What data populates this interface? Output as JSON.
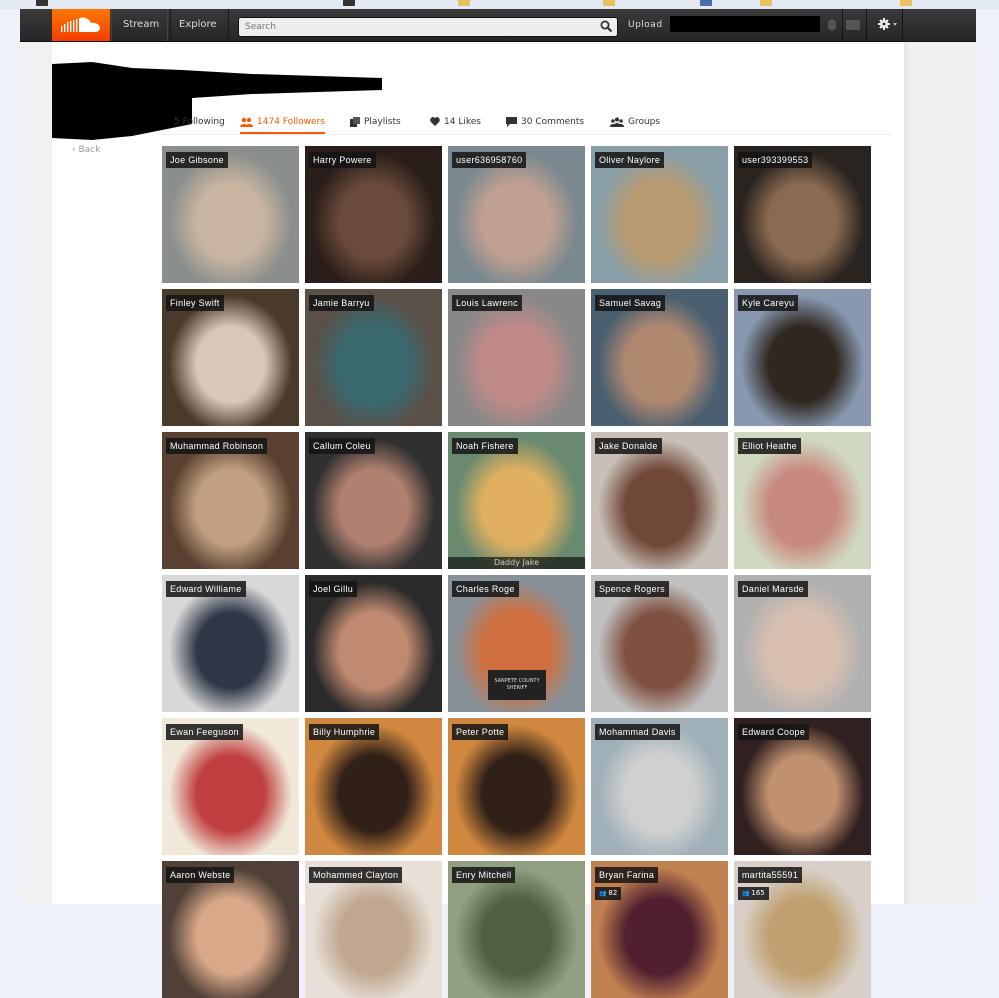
{
  "nav": {
    "stream": "Stream",
    "explore": "Explore",
    "search_placeholder": "Search",
    "upload": "Upload",
    "brand_color": "#ff5500"
  },
  "tabs": [
    {
      "label": "5 Following",
      "icon": "users-icon",
      "active": false
    },
    {
      "label": "1474 Followers",
      "icon": "users-icon",
      "active": true
    },
    {
      "label": "Playlists",
      "icon": "playlist-icon",
      "active": false
    },
    {
      "label": "14 Likes",
      "icon": "heart-icon",
      "active": false
    },
    {
      "label": "30 Comments",
      "icon": "comment-icon",
      "active": false
    },
    {
      "label": "Groups",
      "icon": "groups-icon",
      "active": false
    }
  ],
  "back_label": "Back",
  "followers": [
    {
      "name": "Joe Gibsone"
    },
    {
      "name": "Harry Powere"
    },
    {
      "name": "user636958760"
    },
    {
      "name": "Oliver Naylore"
    },
    {
      "name": "user393399553"
    },
    {
      "name": "Finley Swift"
    },
    {
      "name": "Jamie Barryu"
    },
    {
      "name": "Louis Lawrenc"
    },
    {
      "name": "Samuel Savag"
    },
    {
      "name": "Kyle Careyu"
    },
    {
      "name": "Muhammad Robinson"
    },
    {
      "name": "Callum Coleu"
    },
    {
      "name": "Noah Fishere",
      "caption": "Daddy Jake"
    },
    {
      "name": "Jake Donalde"
    },
    {
      "name": "Elliot Heathe"
    },
    {
      "name": "Edward Williame"
    },
    {
      "name": "Joel Gillu"
    },
    {
      "name": "Charles Roge",
      "sign": "SANPETE COUNTY SHERIFF"
    },
    {
      "name": "Spence Rogers"
    },
    {
      "name": "Daniel Marsde"
    },
    {
      "name": "Ewan Feeguson"
    },
    {
      "name": "Billy Humphrie"
    },
    {
      "name": "Peter Potte"
    },
    {
      "name": "Mohammad Davis"
    },
    {
      "name": "Edward Coope"
    },
    {
      "name": "Aaron Webste"
    },
    {
      "name": "Mohammed Clayton"
    },
    {
      "name": "Enry Mitchell"
    },
    {
      "name": "Bryan Farina",
      "followers": "82"
    },
    {
      "name": "martita55591",
      "followers": "165"
    }
  ]
}
